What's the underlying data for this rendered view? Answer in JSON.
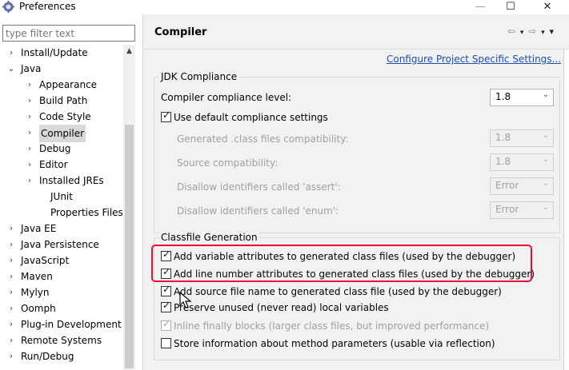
{
  "window": {
    "title": "Preferences",
    "minimize_glyph": "—",
    "maximize_glyph": "☐",
    "close_glyph": "✕"
  },
  "filter": {
    "placeholder": "type filter text",
    "value": ""
  },
  "tree": {
    "items": [
      {
        "label": "Install/Update",
        "twisty": "›"
      },
      {
        "label": "Java",
        "twisty": "⌄"
      },
      {
        "label": "Appearance",
        "twisty": "›"
      },
      {
        "label": "Build Path",
        "twisty": "›"
      },
      {
        "label": "Code Style",
        "twisty": "›"
      },
      {
        "label": "Compiler",
        "twisty": "›"
      },
      {
        "label": "Debug",
        "twisty": "›"
      },
      {
        "label": "Editor",
        "twisty": "›"
      },
      {
        "label": "Installed JREs",
        "twisty": "›"
      },
      {
        "label": "JUnit",
        "twisty": ""
      },
      {
        "label": "Properties Files Ed",
        "twisty": ""
      },
      {
        "label": "Java EE",
        "twisty": "›"
      },
      {
        "label": "Java Persistence",
        "twisty": "›"
      },
      {
        "label": "JavaScript",
        "twisty": "›"
      },
      {
        "label": "Maven",
        "twisty": "›"
      },
      {
        "label": "Mylyn",
        "twisty": "›"
      },
      {
        "label": "Oomph",
        "twisty": "›"
      },
      {
        "label": "Plug-in Development",
        "twisty": "›"
      },
      {
        "label": "Remote Systems",
        "twisty": "›"
      },
      {
        "label": "Run/Debug",
        "twisty": "›"
      }
    ],
    "selected": "Compiler"
  },
  "header": {
    "title": "Compiler",
    "nav_back": "⇦",
    "nav_forward": "⇨",
    "dropdown": "▾",
    "menu": "▾"
  },
  "configure_link": "Configure Project Specific Settings...",
  "jdk": {
    "legend": "JDK Compliance",
    "compliance_label": "Compiler compliance level:",
    "compliance_value": "1.8",
    "use_default_label": "Use default compliance settings",
    "use_default_checked": true,
    "generated_label": "Generated .class files compatibility:",
    "generated_value": "1.8",
    "source_label": "Source compatibility:",
    "source_value": "1.8",
    "assert_label": "Disallow identifiers called 'assert':",
    "assert_value": "Error",
    "enum_label": "Disallow identifiers called 'enum':",
    "enum_value": "Error"
  },
  "classfile": {
    "legend": "Classfile Generation",
    "options": [
      {
        "label": "Add variable attributes to generated class files (used by the debugger)",
        "checked": true,
        "enabled": true
      },
      {
        "label": "Add line number attributes to generated class files (used by the debugger)",
        "checked": true,
        "enabled": true
      },
      {
        "label": "Add source file name to generated class file (used by the debugger)",
        "checked": true,
        "enabled": true
      },
      {
        "label": "Preserve unused (never read) local variables",
        "checked": true,
        "enabled": true
      },
      {
        "label": "Inline finally blocks (larger class files, but improved performance)",
        "checked": true,
        "enabled": false
      },
      {
        "label": "Store information about method parameters (usable via reflection)",
        "checked": false,
        "enabled": true
      }
    ]
  },
  "colors": {
    "highlight": "#e8103a",
    "link": "#1a4fb0",
    "pane_bg": "#f2f2f2"
  }
}
